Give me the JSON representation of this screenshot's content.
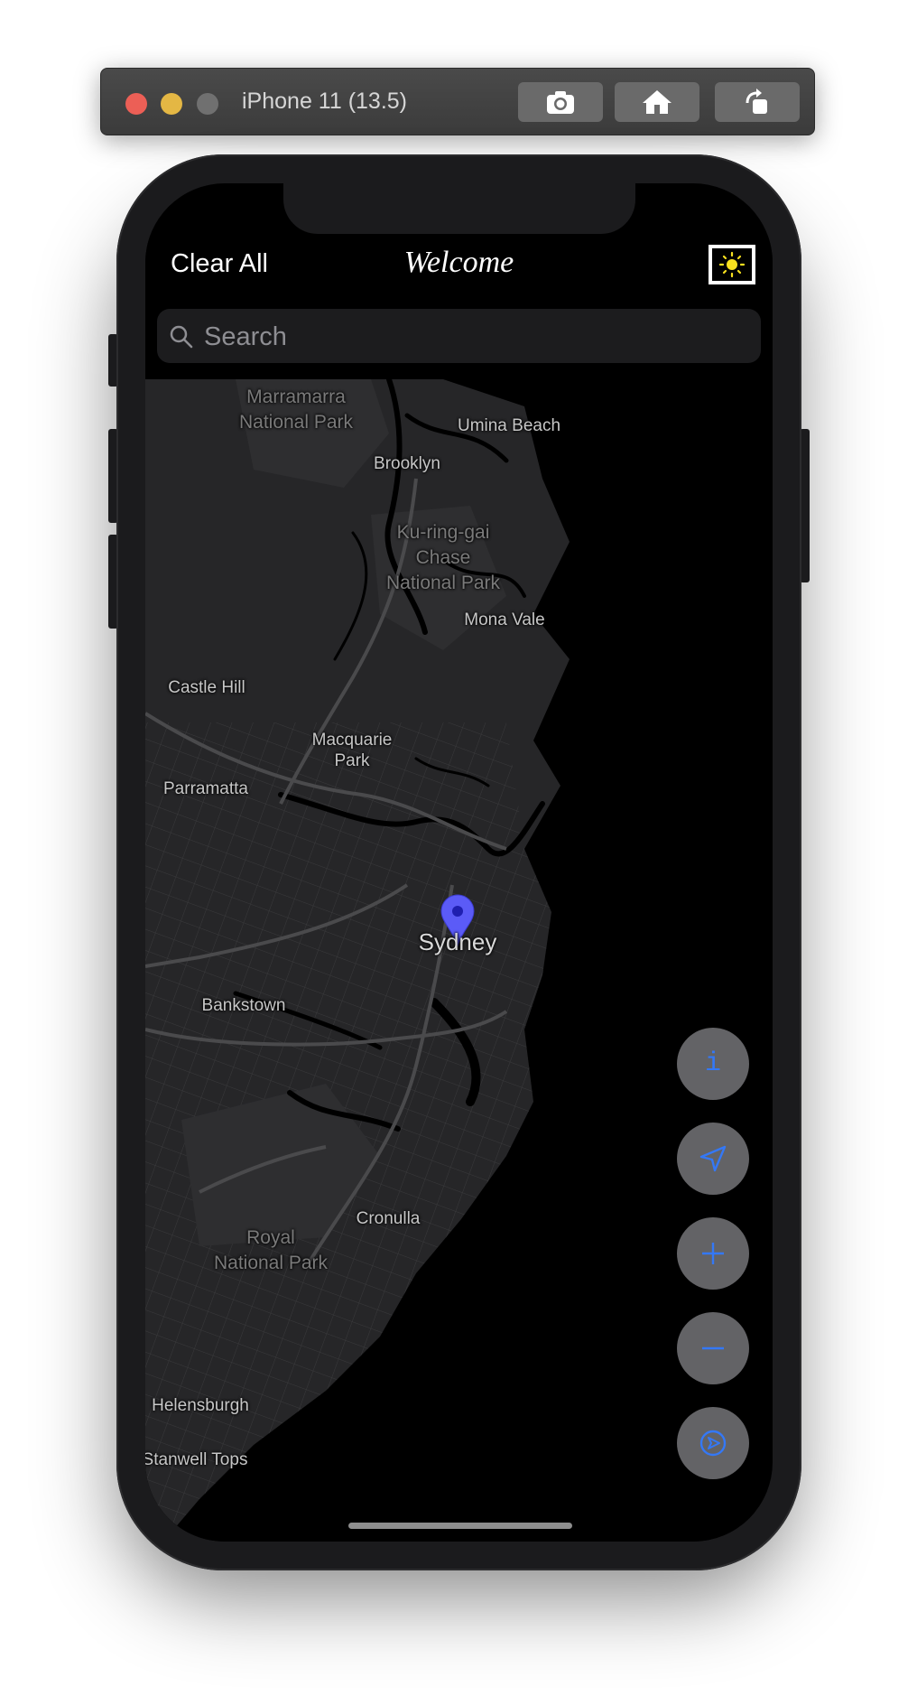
{
  "simulator": {
    "title": "iPhone 11 (13.5)",
    "buttons": [
      "camera-icon",
      "home-icon",
      "rotate-icon"
    ]
  },
  "app": {
    "nav": {
      "left_button": "Clear All",
      "title": "Welcome",
      "right_button_icon": "sun-icon"
    },
    "search": {
      "placeholder": "Search",
      "value": ""
    }
  },
  "map": {
    "places": [
      {
        "name": "Marramarra National Park",
        "type": "park",
        "lines": [
          "Marramarra",
          "National Park"
        ]
      },
      {
        "name": "Umina Beach",
        "type": "suburb"
      },
      {
        "name": "Brooklyn",
        "type": "suburb"
      },
      {
        "name": "Ku-ring-gai Chase National Park",
        "type": "park",
        "lines": [
          "Ku-ring-gai",
          "Chase",
          "National Park"
        ]
      },
      {
        "name": "Mona Vale",
        "type": "suburb"
      },
      {
        "name": "Castle Hill",
        "type": "suburb"
      },
      {
        "name": "Macquarie Park",
        "type": "suburb",
        "lines": [
          "Macquarie",
          "Park"
        ]
      },
      {
        "name": "Parramatta",
        "type": "suburb"
      },
      {
        "name": "Sydney",
        "type": "city"
      },
      {
        "name": "Bankstown",
        "type": "suburb"
      },
      {
        "name": "Cronulla",
        "type": "suburb"
      },
      {
        "name": "Royal National Park",
        "type": "park",
        "lines": [
          "Royal",
          "National Park"
        ]
      },
      {
        "name": "Helensburgh",
        "type": "suburb"
      },
      {
        "name": "Stanwell Tops",
        "type": "suburb"
      }
    ],
    "pin": {
      "label": "Sydney",
      "color": "#5b5bf7"
    },
    "controls": [
      "info-icon",
      "location-arrow-icon",
      "zoom-in-icon",
      "zoom-out-icon",
      "compass-settings-icon"
    ],
    "accent": "#3478f6"
  }
}
